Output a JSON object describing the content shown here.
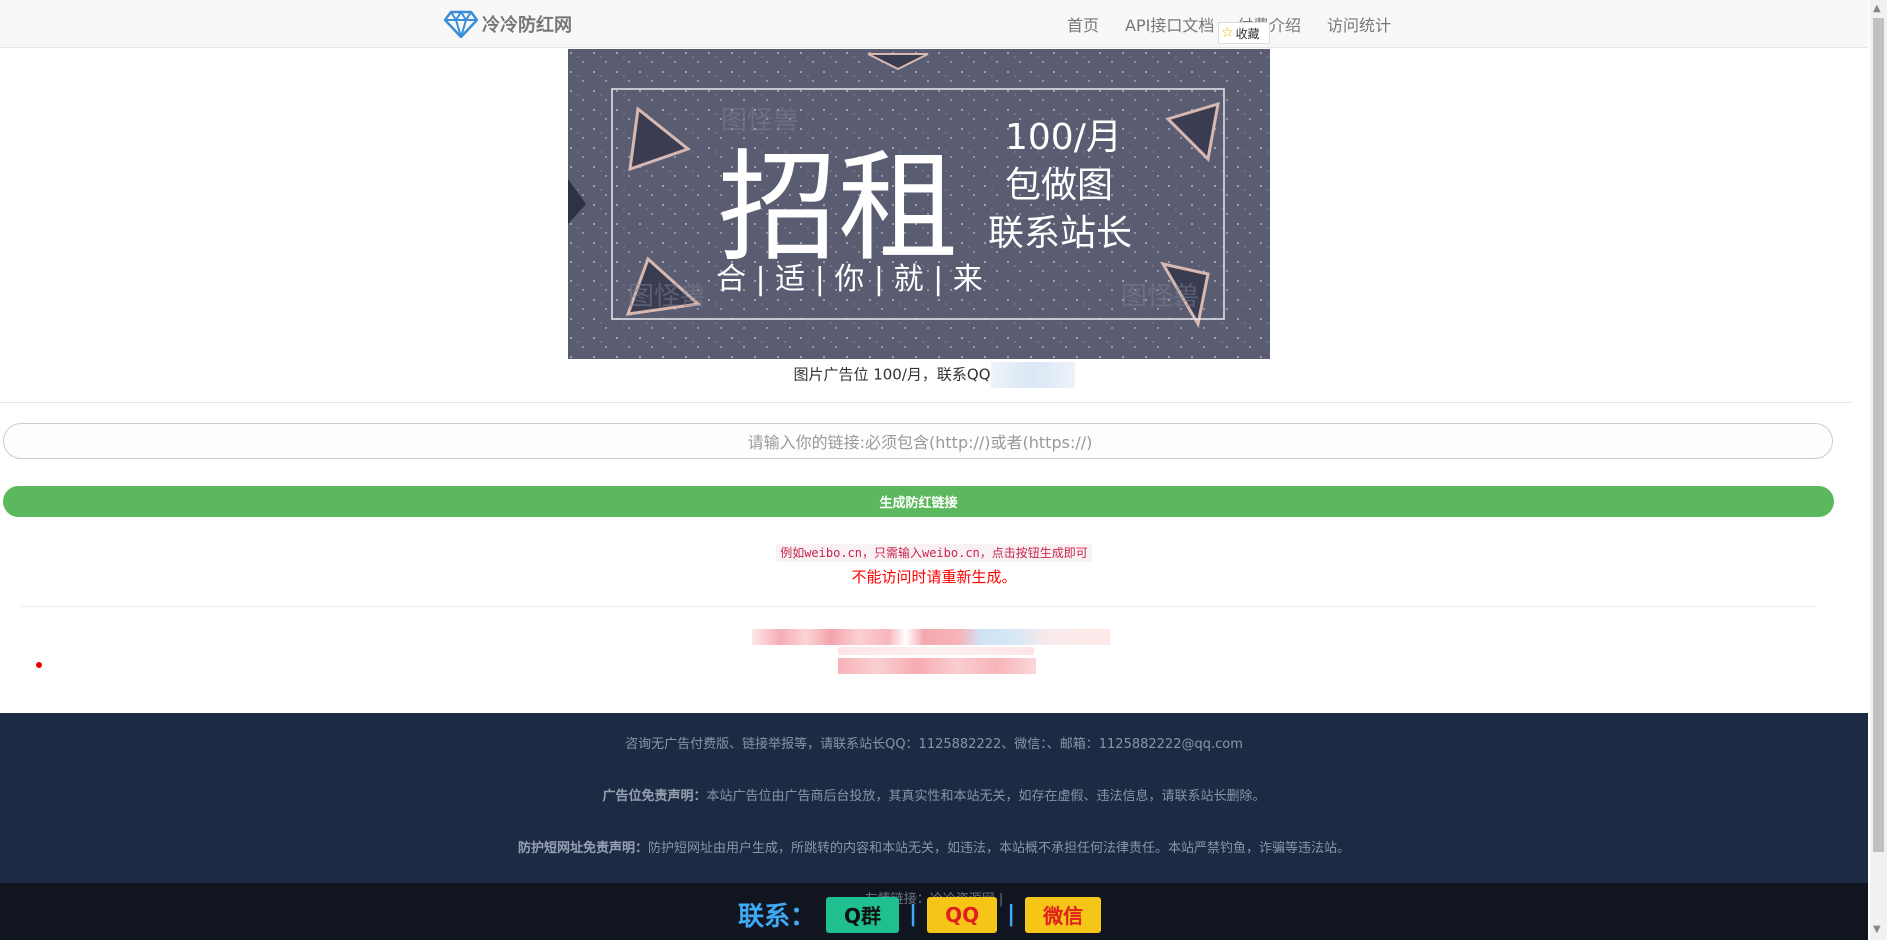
{
  "nav": {
    "brand": "冷冷防红网",
    "links": [
      "首页",
      "API接口文档",
      "付费介绍",
      "访问统计"
    ],
    "favorite_label": "收藏"
  },
  "banner": {
    "big_text": "招租",
    "price": "100/月",
    "line2": "包做图",
    "line3": "联系站长",
    "bottom_line": "合 | 适 | 你 | 就 | 来",
    "watermark": "图怪兽"
  },
  "ad_caption": "图片广告位 100/月，联系QQ",
  "form": {
    "link_placeholder": "请输入你的链接:必须包含(http://)或者(https://)",
    "generate_label": "生成防红链接"
  },
  "example_text": "例如weibo.cn，只需输入weibo.cn，点击按钮生成即可",
  "regenerate_tip": "不能访问时请重新生成。",
  "footer": {
    "contact_line": "咨询无广告付费版、链接举报等，请联系站长QQ：1125882222、微信：、邮箱：1125882222@qq.com",
    "ad_disclaimer_title": "广告位免责声明：",
    "ad_disclaimer_text": "本站广告位由广告商后台投放，其真实性和本站无关，如存在虚假、违法信息，请联系站长删除。",
    "url_disclaimer_title": "防护短网址免责声明：",
    "url_disclaimer_text": "防护短网址由用户生成，所跳转的内容和本站无关，如违法，本站概不承担任何法律责任。本站严禁钓鱼，诈骗等违法站。",
    "friend_links": "友情链接：冷冷资源网 |"
  },
  "contact_bar": {
    "label": "联系：",
    "buttons": [
      {
        "label": "Q群",
        "bg": "#1fbf8f",
        "color": "#111111"
      },
      {
        "label": "QQ",
        "bg": "#f5c518",
        "color": "#e02020"
      },
      {
        "label": "微信",
        "bg": "#f5c518",
        "color": "#e02020"
      }
    ],
    "separator": "|"
  },
  "colors": {
    "accent_green": "#5cb85c",
    "footer_bg": "#1c2a44",
    "tip_red": "#ff0000",
    "brand_blue": "#3fa9f5"
  }
}
